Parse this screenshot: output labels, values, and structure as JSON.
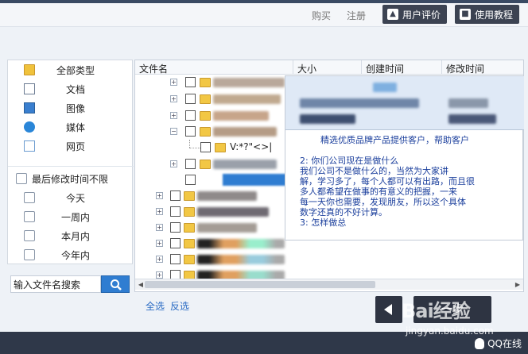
{
  "topnav": {
    "buy": "购买",
    "register": "注册",
    "user_review": "用户评价",
    "tutorial": "使用教程"
  },
  "left_panel": {
    "categories": [
      "全部类型",
      "文档",
      "图像",
      "媒体",
      "网页"
    ],
    "time_header": "最后修改时间不限",
    "time_items": [
      "今天",
      "一周内",
      "本月内",
      "今年内"
    ]
  },
  "search": {
    "placeholder": "输入文件名搜索"
  },
  "file_table": {
    "columns": [
      "文件名",
      "大小",
      "创建时间",
      "修改时间"
    ],
    "visible_row_text": "V:*?\"<>|"
  },
  "bottom": {
    "select_all": "全选",
    "invert": "反选",
    "next": "一步"
  },
  "footer": {
    "qq_online": "QQ在线"
  },
  "watermark": {
    "logo": "Bai经验",
    "url": "jingyan.baidu.com"
  },
  "popup": {
    "title": "█",
    "lines": [
      "精选优质品牌产品提供客户，帮助客户",
      "2: 你们公司现在是做什么",
      "我们公司不是做什么的，当然为大家讲",
      "解，学习多了，每个人都可以有出路，而且很",
      "多人都希望在做事的有意义的把握，一来",
      "每一天你也需要，发现朋友，所以这个具体",
      "数字还真的不好计算。",
      "3: 怎样做总"
    ]
  }
}
